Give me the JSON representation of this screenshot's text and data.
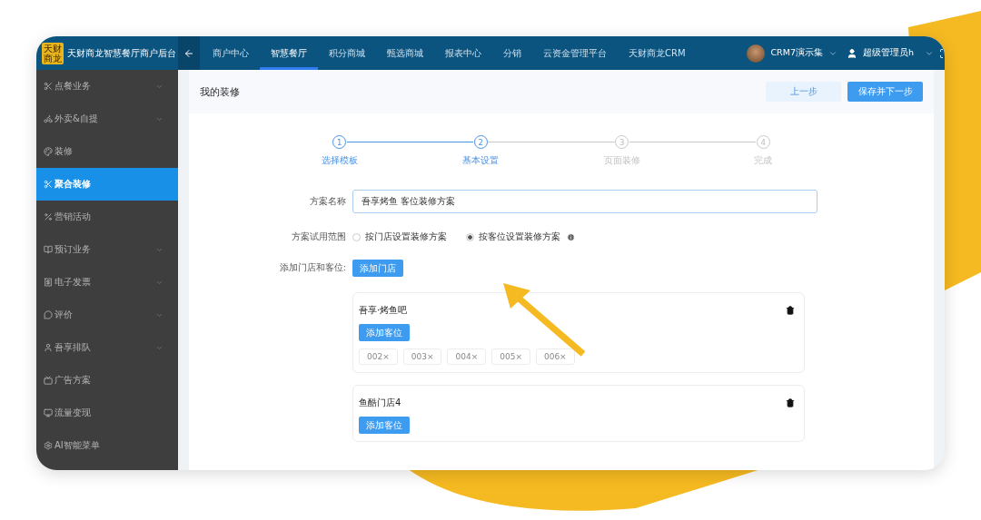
{
  "brand": {
    "logo": "天财商龙",
    "title": "天财商龙智慧餐厅商户后台"
  },
  "nav": [
    {
      "label": "商户中心",
      "selected": false
    },
    {
      "label": "智慧餐厅",
      "selected": true
    },
    {
      "label": "积分商城",
      "selected": false
    },
    {
      "label": "甄选商城",
      "selected": false
    },
    {
      "label": "报表中心",
      "selected": false
    },
    {
      "label": "分销",
      "selected": false
    },
    {
      "label": "云资金管理平台",
      "selected": false
    },
    {
      "label": "天财商龙CRM",
      "selected": false
    }
  ],
  "account": {
    "group": "CRM7演示集",
    "user": "超级管理员h"
  },
  "sidebar": [
    {
      "label": "点餐业务",
      "expandable": true,
      "selected": false
    },
    {
      "label": "外卖&自提",
      "expandable": true,
      "selected": false
    },
    {
      "label": "装修",
      "expandable": false,
      "selected": false
    },
    {
      "label": "聚合装修",
      "expandable": false,
      "selected": true
    },
    {
      "label": "营销活动",
      "expandable": false,
      "selected": false
    },
    {
      "label": "预订业务",
      "expandable": true,
      "selected": false
    },
    {
      "label": "电子发票",
      "expandable": true,
      "selected": false
    },
    {
      "label": "评价",
      "expandable": true,
      "selected": false
    },
    {
      "label": "吾享排队",
      "expandable": true,
      "selected": false
    },
    {
      "label": "广告方案",
      "expandable": false,
      "selected": false
    },
    {
      "label": "流量变现",
      "expandable": false,
      "selected": false
    },
    {
      "label": "AI智能菜单",
      "expandable": false,
      "selected": false
    }
  ],
  "page_title": "我的装修",
  "actions": [
    {
      "label": "上一步",
      "kind": "secondary"
    },
    {
      "label": "保存并下一步",
      "kind": "primary"
    }
  ],
  "steps": [
    {
      "number": "1",
      "label": "选择模板",
      "active": true
    },
    {
      "number": "2",
      "label": "基本设置",
      "active": true
    },
    {
      "number": "3",
      "label": "页面装修",
      "active": false
    },
    {
      "number": "4",
      "label": "完成",
      "active": false
    }
  ],
  "form": {
    "name_label": "方案名称",
    "name_value": "吾享烤鱼 客位装修方案",
    "scope_label": "方案试用范围",
    "scope_options": [
      {
        "label": "按门店设置装修方案",
        "selected": false
      },
      {
        "label": "按客位设置装修方案",
        "selected": true
      }
    ],
    "stores_label": "添加门店和客位:",
    "add_store": "添加门店"
  },
  "stores": [
    {
      "name": "吾享·烤鱼吧",
      "add_seat": "添加客位",
      "seats": [
        "002×",
        "003×",
        "004×",
        "005×",
        "006×"
      ]
    },
    {
      "name": "鱼酷门店4",
      "add_seat": "添加客位"
    }
  ]
}
